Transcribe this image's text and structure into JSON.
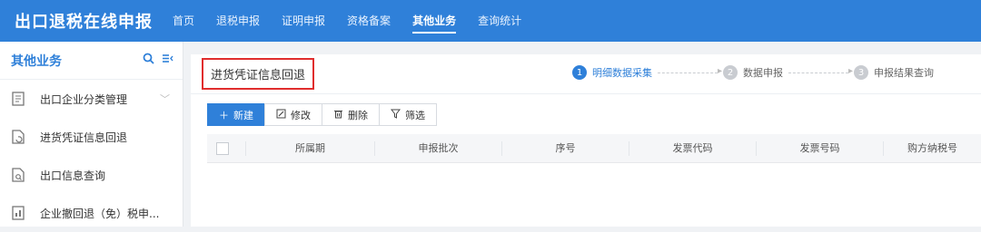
{
  "app": {
    "title": "出口退税在线申报"
  },
  "nav": {
    "items": [
      {
        "label": "首页"
      },
      {
        "label": "退税申报"
      },
      {
        "label": "证明申报"
      },
      {
        "label": "资格备案"
      },
      {
        "label": "其他业务"
      },
      {
        "label": "查询统计"
      }
    ],
    "active": "其他业务"
  },
  "sidebar": {
    "title": "其他业务",
    "items": [
      {
        "label": "出口企业分类管理",
        "icon": "document-icon"
      },
      {
        "label": "进货凭证信息回退",
        "icon": "document-return-icon"
      },
      {
        "label": "出口信息查询",
        "icon": "document-search-icon"
      },
      {
        "label": "企业撤回退（免）税申...",
        "icon": "report-icon"
      }
    ]
  },
  "main": {
    "title": "进货凭证信息回退",
    "steps": [
      {
        "num": "1",
        "label": "明细数据采集"
      },
      {
        "num": "2",
        "label": "数据申报"
      },
      {
        "num": "3",
        "label": "申报结果查询"
      }
    ],
    "toolbar": {
      "new": "新建",
      "edit": "修改",
      "delete": "删除",
      "filter": "筛选"
    },
    "table": {
      "columns": [
        "所属期",
        "申报批次",
        "序号",
        "发票代码",
        "发票号码",
        "购方纳税号"
      ]
    }
  },
  "colors": {
    "brand": "#2f80d9",
    "highlight": "#e02d2d"
  }
}
